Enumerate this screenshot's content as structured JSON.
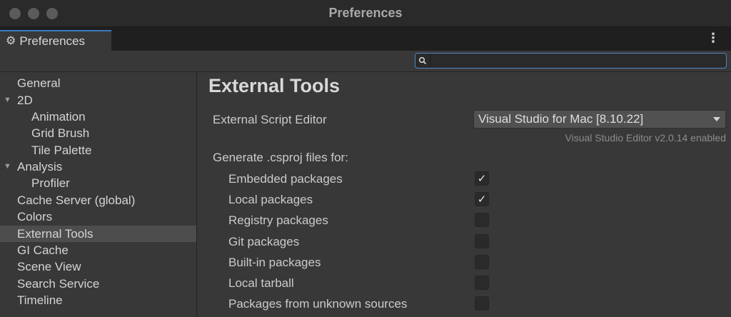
{
  "window": {
    "title": "Preferences",
    "traffic_light_color": "#5b5b5b"
  },
  "tab": {
    "label": "Preferences",
    "icon": "gear-icon",
    "accent": "#3a79bb"
  },
  "toolbar": {
    "menu_icon": "more-vertical-icon"
  },
  "search": {
    "value": "",
    "placeholder": "",
    "icon": "search-icon"
  },
  "sidebar": {
    "selected": "External Tools",
    "items": [
      {
        "label": "General"
      },
      {
        "label": "2D",
        "expanded": true
      },
      {
        "label": "Animation"
      },
      {
        "label": "Grid Brush"
      },
      {
        "label": "Tile Palette"
      },
      {
        "label": "Analysis",
        "expanded": true
      },
      {
        "label": "Profiler"
      },
      {
        "label": "Cache Server (global)"
      },
      {
        "label": "Colors"
      },
      {
        "label": "External Tools"
      },
      {
        "label": "GI Cache"
      },
      {
        "label": "Scene View"
      },
      {
        "label": "Search Service"
      },
      {
        "label": "Timeline"
      }
    ]
  },
  "main": {
    "heading": "External Tools",
    "script_editor": {
      "label": "External Script Editor",
      "value": "Visual Studio for Mac [8.10.22]",
      "hint": "Visual Studio Editor v2.0.14 enabled"
    },
    "csproj": {
      "label": "Generate .csproj files for:",
      "options": [
        {
          "label": "Embedded packages",
          "checked": true
        },
        {
          "label": "Local packages",
          "checked": true
        },
        {
          "label": "Registry packages",
          "checked": false
        },
        {
          "label": "Git packages",
          "checked": false
        },
        {
          "label": "Built-in packages",
          "checked": false
        },
        {
          "label": "Local tarball",
          "checked": false
        },
        {
          "label": "Packages from unknown sources",
          "checked": false
        }
      ]
    }
  }
}
